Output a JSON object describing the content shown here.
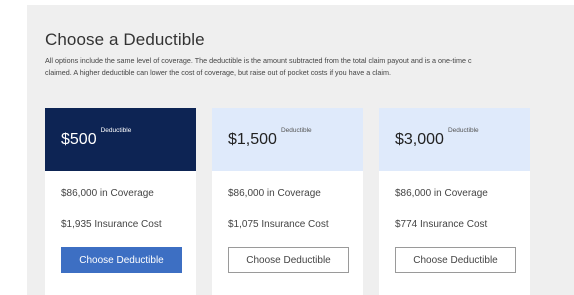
{
  "header": {
    "title": "Choose a Deductible",
    "description_line1": "All options include the same level of coverage. The deductible is the amount subtracted from the total claim payout and is a one-time c",
    "description_line2": "claimed. A higher deductible can lower the cost of coverage, but raise out of pocket costs if you have a claim."
  },
  "options": [
    {
      "amount": "$500",
      "sup_label": "Deductible",
      "coverage": "$86,000 in Coverage",
      "cost": "$1,935 Insurance Cost",
      "button_label": "Choose Deductible",
      "selected": true
    },
    {
      "amount": "$1,500",
      "sup_label": "Deductible",
      "coverage": "$86,000 in Coverage",
      "cost": "$1,075 Insurance Cost",
      "button_label": "Choose Deductible",
      "selected": false
    },
    {
      "amount": "$3,000",
      "sup_label": "Deductible",
      "coverage": "$86,000 in Coverage",
      "cost": "$774 Insurance Cost",
      "button_label": "Choose Deductible",
      "selected": false
    }
  ],
  "colors": {
    "selected_header": "#0d2454",
    "unselected_header": "#dfeafb",
    "primary_button": "#3d6fc3"
  }
}
